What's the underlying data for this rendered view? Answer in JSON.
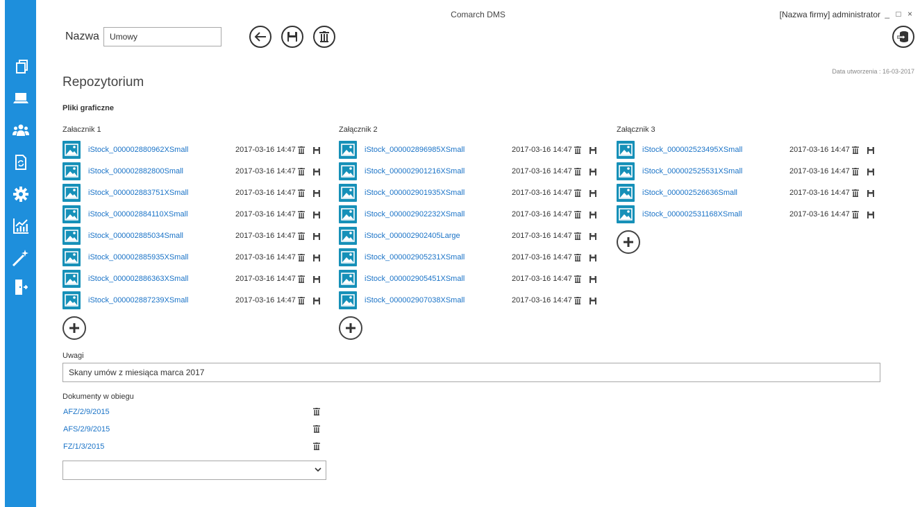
{
  "window": {
    "app_title": "Comarch DMS",
    "company_user": "[Nazwa firmy]  administrator",
    "controls": "_ □ ×"
  },
  "sidebar": {
    "items": [
      {
        "icon": "documents-icon"
      },
      {
        "icon": "workstation-icon"
      },
      {
        "icon": "users-icon"
      },
      {
        "icon": "document-sync-icon"
      },
      {
        "icon": "gear-icon"
      },
      {
        "icon": "chart-icon"
      },
      {
        "icon": "magic-wand-icon"
      },
      {
        "icon": "exit-door-icon"
      }
    ]
  },
  "toolbar": {
    "name_label": "Nazwa",
    "name_value": "Umowy"
  },
  "header": {
    "created": "Data utworzenia : 16-03-2017",
    "title": "Repozytorium",
    "section": "Pliki graficzne"
  },
  "attachments": [
    {
      "title": "Załacznik 1",
      "files": [
        {
          "name": "iStock_000002880962XSmall",
          "date": "2017-03-16 14:47"
        },
        {
          "name": "iStock_000002882800Small",
          "date": "2017-03-16 14:47"
        },
        {
          "name": "iStock_000002883751XSmall",
          "date": "2017-03-16 14:47"
        },
        {
          "name": "iStock_000002884110XSmall",
          "date": "2017-03-16 14:47"
        },
        {
          "name": "iStock_000002885034Small",
          "date": "2017-03-16 14:47"
        },
        {
          "name": "iStock_000002885935XSmall",
          "date": "2017-03-16 14:47"
        },
        {
          "name": "iStock_000002886363XSmall",
          "date": "2017-03-16 14:47"
        },
        {
          "name": "iStock_000002887239XSmall",
          "date": "2017-03-16 14:47"
        }
      ]
    },
    {
      "title": "Załącznik 2",
      "files": [
        {
          "name": "iStock_000002896985XSmall",
          "date": "2017-03-16 14:47"
        },
        {
          "name": "iStock_000002901216XSmall",
          "date": "2017-03-16 14:47"
        },
        {
          "name": "iStock_000002901935XSmall",
          "date": "2017-03-16 14:47"
        },
        {
          "name": "iStock_000002902232XSmall",
          "date": "2017-03-16 14:47"
        },
        {
          "name": "iStock_000002902405Large",
          "date": "2017-03-16 14:47"
        },
        {
          "name": "iStock_000002905231XSmall",
          "date": "2017-03-16 14:47"
        },
        {
          "name": "iStock_000002905451XSmall",
          "date": "2017-03-16 14:47"
        },
        {
          "name": "iStock_000002907038XSmall",
          "date": "2017-03-16 14:47"
        }
      ]
    },
    {
      "title": "Załącznik 3",
      "files": [
        {
          "name": "iStock_000002523495XSmall",
          "date": "2017-03-16 14:47"
        },
        {
          "name": "iStock_000002525531XSmall",
          "date": "2017-03-16 14:47"
        },
        {
          "name": "iStock_000002526636Small",
          "date": "2017-03-16 14:47"
        },
        {
          "name": "iStock_000002531168XSmall",
          "date": "2017-03-16 14:47"
        }
      ]
    }
  ],
  "notes": {
    "label": "Uwagi",
    "value": "Skany umów z miesiąca marca 2017"
  },
  "documents": {
    "label": "Dokumenty w obiegu",
    "items": [
      "AFZ/2/9/2015",
      "AFS/2/9/2015",
      "FZ/1/3/2015"
    ],
    "select_value": ""
  },
  "colors": {
    "sidebar": "#1e8fdc",
    "link": "#1a73c7",
    "thumb": "#1690b8"
  }
}
